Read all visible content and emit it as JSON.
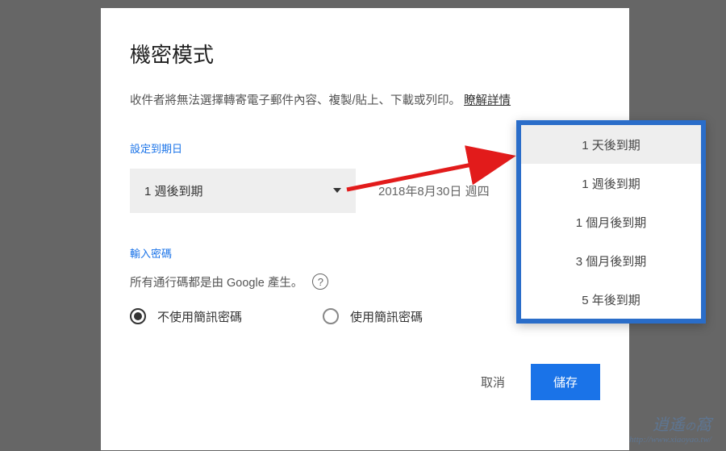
{
  "dialog": {
    "title": "機密模式",
    "description": "收件者將無法選擇轉寄電子郵件內容、複製/貼上、下載或列印。",
    "learn_more": "瞭解詳情"
  },
  "expiry": {
    "label": "設定到期日",
    "selected": "1 週後到期",
    "date": "2018年8月30日 週四",
    "options": [
      "1 天後到期",
      "1 週後到期",
      "1 個月後到期",
      "3 個月後到期",
      "5 年後到期"
    ]
  },
  "password": {
    "label": "輸入密碼",
    "description": "所有通行碼都是由 Google 產生。",
    "radio_no_sms": "不使用簡訊密碼",
    "radio_sms": "使用簡訊密碼"
  },
  "buttons": {
    "cancel": "取消",
    "save": "儲存"
  },
  "watermark": {
    "title_a": "逍遙",
    "title_b": "の",
    "title_c": "窩",
    "url": "http://www.xiaoyao.tw/"
  }
}
